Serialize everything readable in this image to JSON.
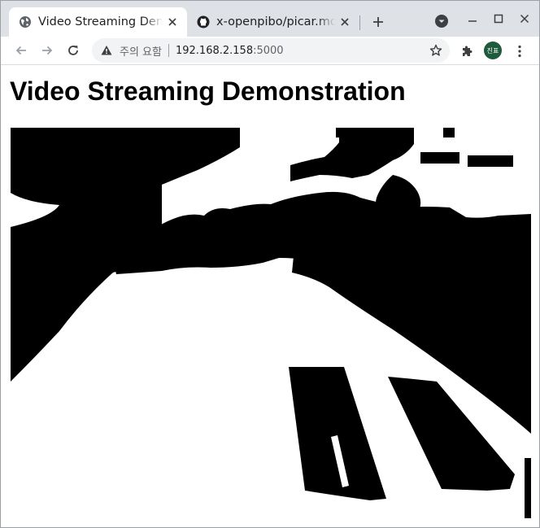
{
  "browser": {
    "tabs": [
      {
        "title": "Video Streaming Demonstration",
        "icon": "globe-icon",
        "active": true
      },
      {
        "title": "x-openpibo/picar.md at main",
        "icon": "github-icon",
        "active": false
      }
    ],
    "address": {
      "security_label": "주의 요함",
      "host": "192.168.2.158",
      "port": ":5000"
    },
    "profile_initials": "진표"
  },
  "page": {
    "heading": "Video Streaming Demonstration"
  },
  "colors": {
    "tabstrip": "#dee1e6",
    "omnibox": "#f1f3f4",
    "avatar": "#1e5a3c"
  }
}
